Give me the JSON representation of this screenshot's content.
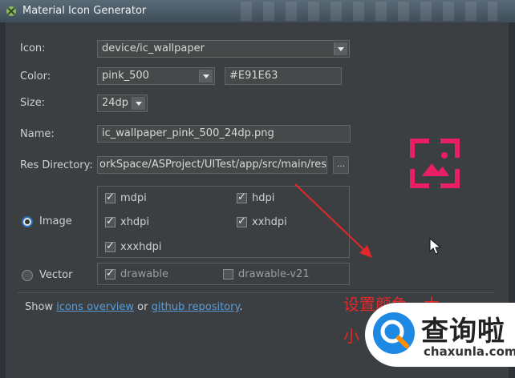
{
  "window": {
    "title": "Material Icon Generator"
  },
  "form": {
    "icon_label": "Icon:",
    "icon_value": "device/ic_wallpaper",
    "color_label": "Color:",
    "color_value": "pink_500",
    "color_hex": "#E91E63",
    "size_label": "Size:",
    "size_value": "24dp",
    "name_label": "Name:",
    "name_value": "ic_wallpaper_pink_500_24dp.png",
    "resdir_label": "Res Directory:",
    "resdir_value": "orkSpace/ASProject/UITest/app/src/main/res",
    "browse_label": "..."
  },
  "image_option": {
    "label": "Image",
    "selected": true,
    "densities": [
      {
        "label": "mdpi",
        "checked": true
      },
      {
        "label": "hdpi",
        "checked": true
      },
      {
        "label": "xhdpi",
        "checked": true
      },
      {
        "label": "xxhdpi",
        "checked": true
      },
      {
        "label": "xxxhdpi",
        "checked": true
      }
    ]
  },
  "vector_option": {
    "label": "Vector",
    "selected": false,
    "drawable_label": "drawable",
    "drawable_checked": true,
    "drawable_v21_label": "drawable-v21",
    "drawable_v21_checked": false
  },
  "footer": {
    "show_text": "Show",
    "icons_overview_link": "icons overview",
    "or_text": "or",
    "github_link": "github repository",
    "period": "."
  },
  "annotation": {
    "line1": "设置颜色、大",
    "line2": "小"
  },
  "watermark": {
    "cn": "查询啦",
    "en": "chaxunla.com"
  },
  "colors": {
    "accent_pink": "#E91E63",
    "link_blue": "#5b9bd5",
    "annotation_red": "#e0282a"
  },
  "icons": {
    "preview": "wallpaper-icon",
    "cursor": "mouse-cursor-icon"
  }
}
